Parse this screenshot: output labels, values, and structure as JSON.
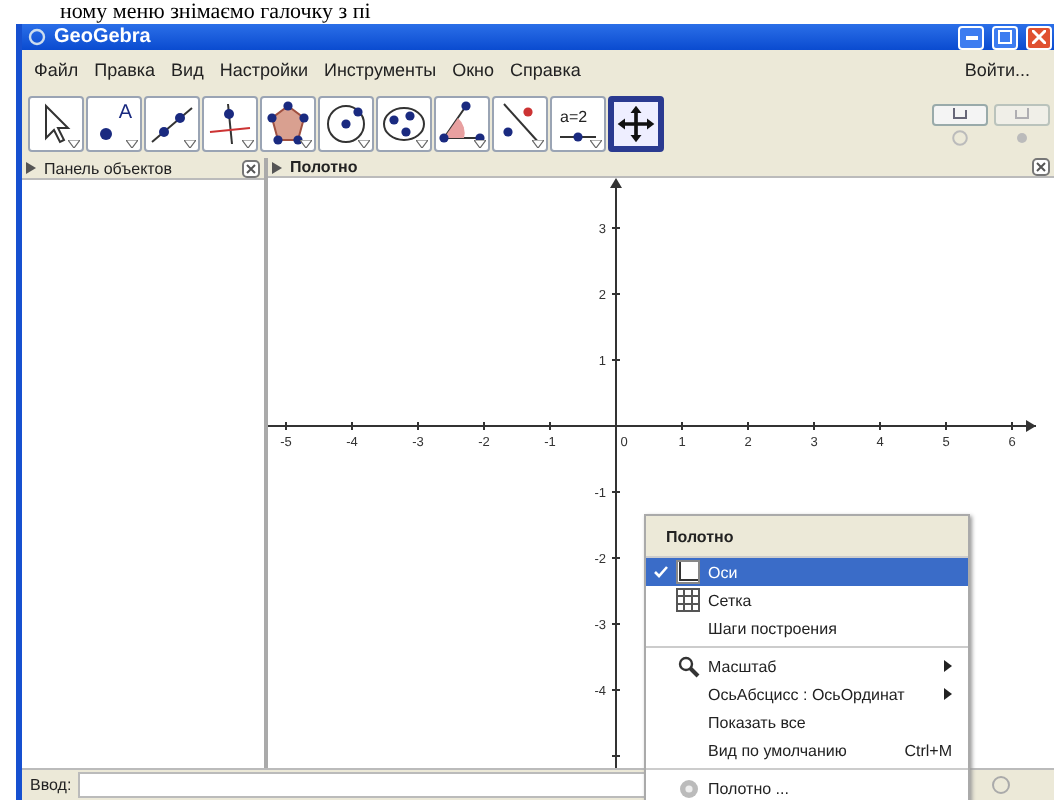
{
  "document_text": "ному меню знімаємо галочку з пі",
  "window": {
    "title": "GeoGebra"
  },
  "menu": [
    "Файл",
    "Правка",
    "Вид",
    "Настройки",
    "Инструменты",
    "Окно",
    "Справка"
  ],
  "login": "Войти...",
  "tools": [
    {
      "kind": "move",
      "selected": false
    },
    {
      "kind": "point",
      "label": "A",
      "selected": false
    },
    {
      "kind": "line",
      "selected": false
    },
    {
      "kind": "perpendicular",
      "selected": false
    },
    {
      "kind": "polygon",
      "selected": false
    },
    {
      "kind": "circle",
      "selected": false
    },
    {
      "kind": "conic",
      "selected": false
    },
    {
      "kind": "angle",
      "selected": false
    },
    {
      "kind": "reflect",
      "selected": false
    },
    {
      "kind": "slider",
      "label": "a=2",
      "selected": false
    },
    {
      "kind": "move_view",
      "selected": true
    }
  ],
  "algebra_panel": {
    "title": "Панель объектов"
  },
  "graphics_panel": {
    "title": "Полотно",
    "x_labels": [
      "-5",
      "-4",
      "-3",
      "-2",
      "-1",
      "0",
      "1",
      "2",
      "3",
      "4",
      "5",
      "6"
    ],
    "y_labels": [
      "3",
      "2",
      "1",
      "-1",
      "-2",
      "-3",
      "-4"
    ]
  },
  "context_menu": {
    "title": "Полотно",
    "items": [
      {
        "kind": "toggle",
        "label": "Оси",
        "checked": true,
        "selected": true
      },
      {
        "kind": "toggle",
        "label": "Сетка",
        "checked": false,
        "selected": false
      },
      {
        "kind": "item",
        "label": "Шаги построения",
        "selected": false
      },
      {
        "kind": "separator"
      },
      {
        "kind": "submenu",
        "label": "Масштаб",
        "selected": false
      },
      {
        "kind": "submenu",
        "label": "ОсьАбсцисс : ОсьОрдинат",
        "selected": false
      },
      {
        "kind": "item",
        "label": "Показать все",
        "selected": false
      },
      {
        "kind": "item",
        "label": "Вид по умолчанию",
        "shortcut": "Ctrl+M",
        "selected": false
      },
      {
        "kind": "separator"
      },
      {
        "kind": "item",
        "label": "Полотно ...",
        "selected": false
      }
    ]
  },
  "input_bar": {
    "label": "Ввод:"
  }
}
